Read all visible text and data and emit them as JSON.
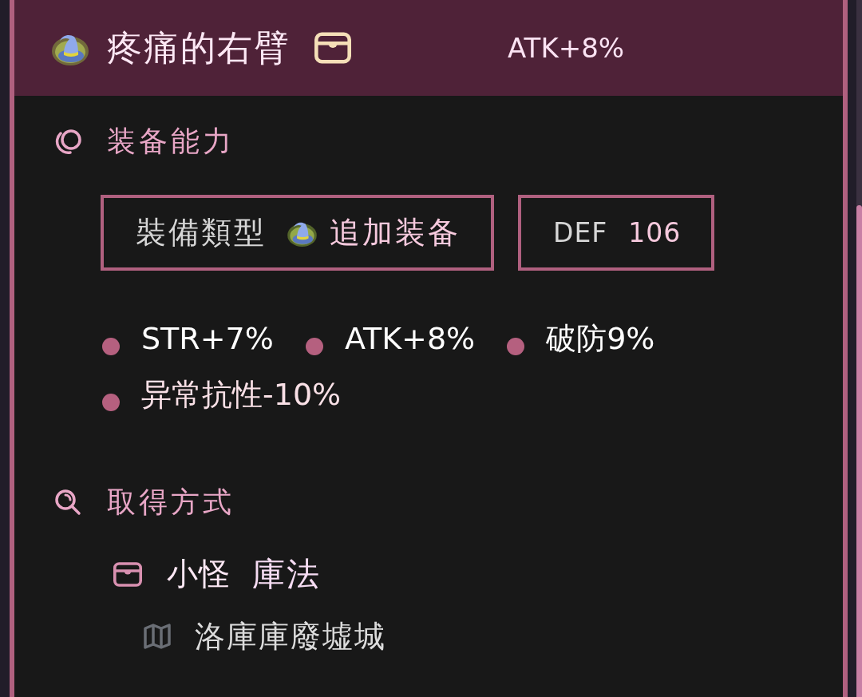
{
  "item": {
    "title": "疼痛的右臂",
    "header_stat": "ATK+8%"
  },
  "equipment_ability": {
    "title": "装备能力",
    "type_box": {
      "label": "裝備類型",
      "value": "追加装备"
    },
    "defense_box": {
      "label": "DEF",
      "value": "106"
    },
    "stats": [
      {
        "text": "STR+7%",
        "kind": "buff"
      },
      {
        "text": "ATK+8%",
        "kind": "buff"
      },
      {
        "text": "破防9%",
        "kind": "buff"
      },
      {
        "text": "异常抗性-10%",
        "kind": "debuff"
      }
    ]
  },
  "acquisition": {
    "title": "取得方式",
    "sources": [
      {
        "monster_type": "小怪",
        "monster_name": "庫法",
        "locations": [
          "洛庫庫廢墟城"
        ]
      }
    ]
  }
}
